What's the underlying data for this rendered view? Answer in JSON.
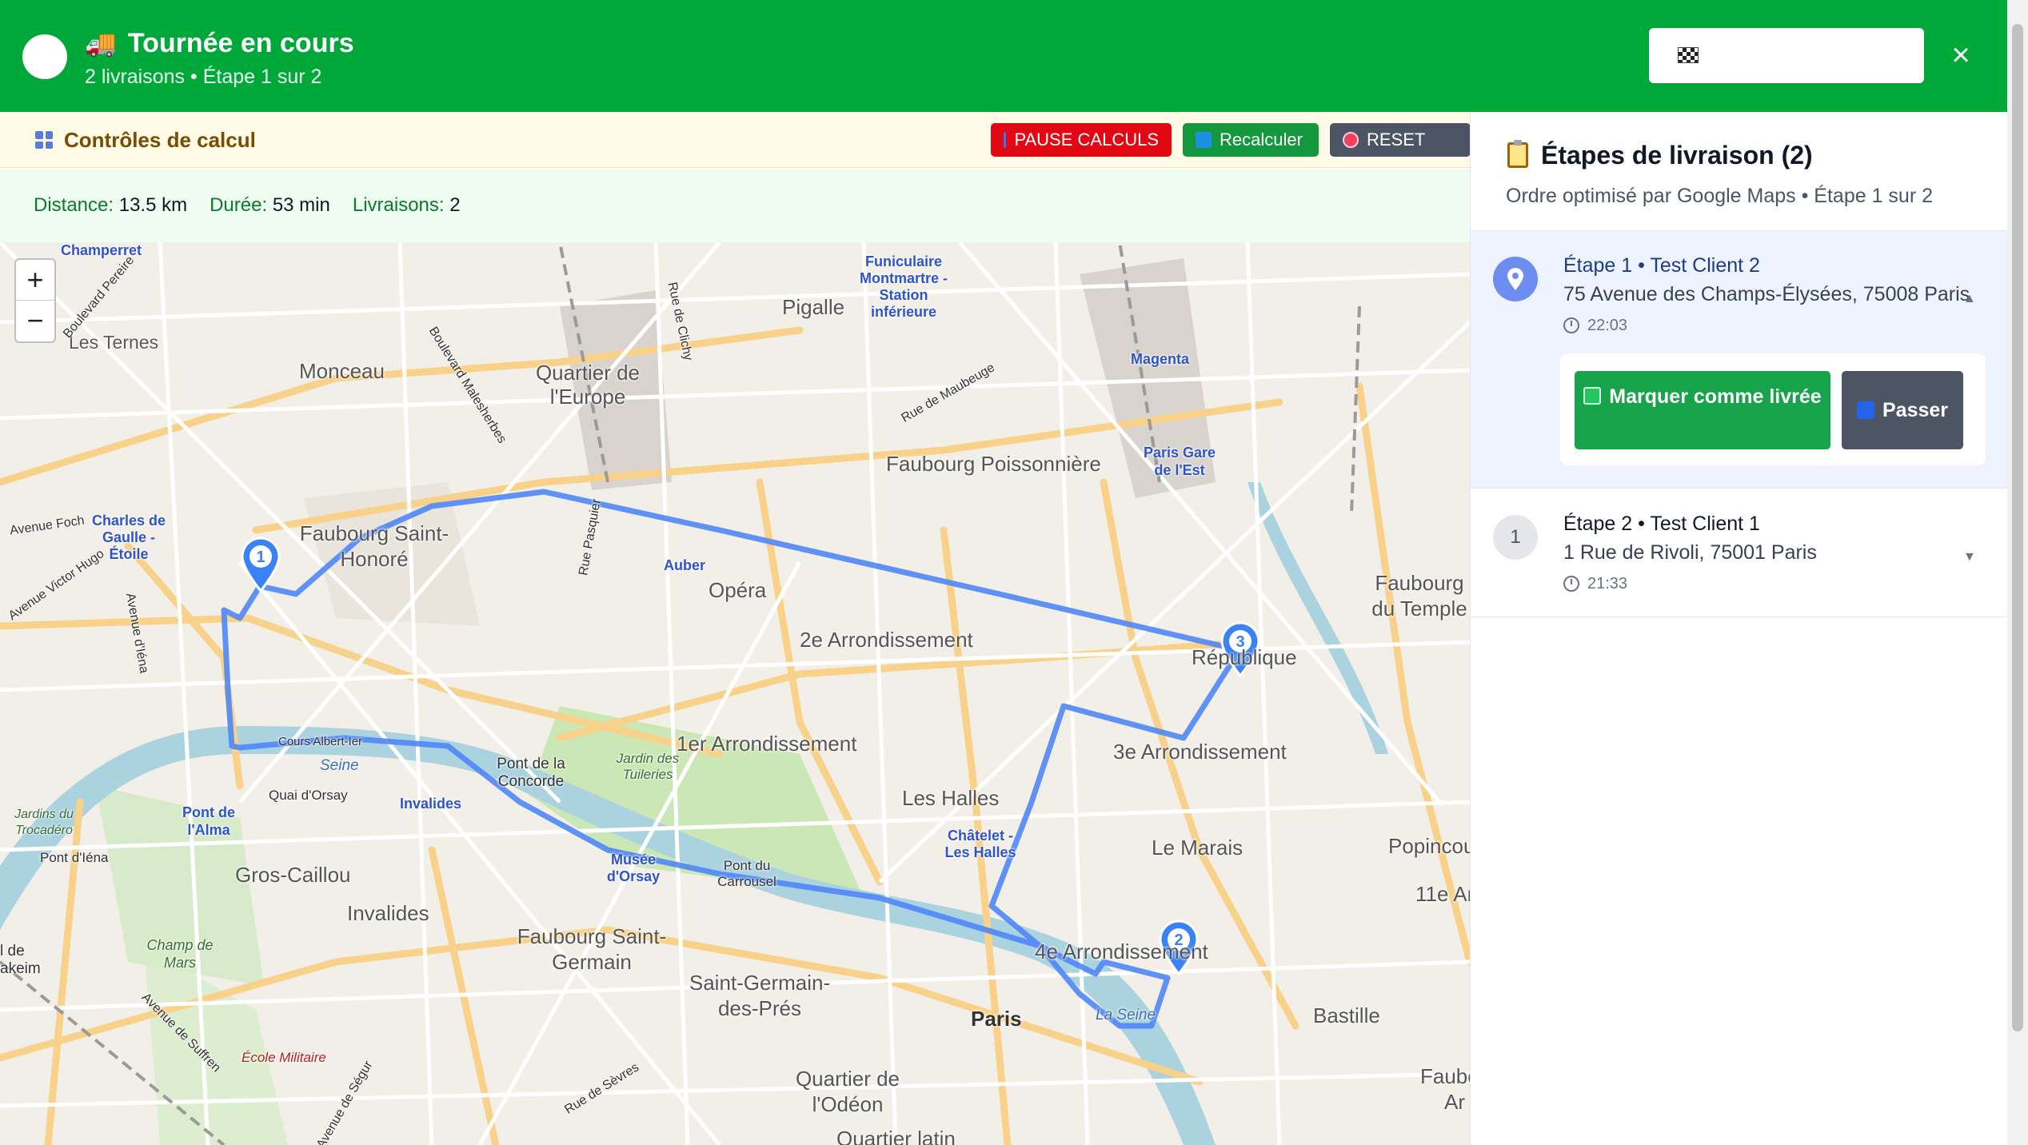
{
  "header": {
    "title": "Tournée en cours",
    "subtitle": "2 livraisons • Étape 1 sur 2",
    "close_label": "×",
    "truck": "🚚"
  },
  "controls": {
    "title": "Contrôles de calcul",
    "pause_label": "PAUSE CALCULS",
    "recalc_label": "Recalculer",
    "reset_label": "RESET"
  },
  "stats": {
    "distance_label": "Distance:",
    "distance_value": "13.5 km",
    "duration_label": "Durée:",
    "duration_value": "53 min",
    "deliveries_label": "Livraisons:",
    "deliveries_value": "2"
  },
  "map": {
    "zoom_in": "+",
    "zoom_out": "−",
    "labels": {
      "champerret": "Champerret",
      "ternes": "Les Ternes",
      "monceau": "Monceau",
      "quartier_europe": "Quartier de l'Europe",
      "pigalle": "Pigalle",
      "funiculaire": "Funiculaire Montmartre - Station inférieure",
      "magenta": "Magenta",
      "faubourg_poissonniere": "Faubourg Poissonnière",
      "gare_est": "Paris Gare de l'Est",
      "charles_de_gaulle": "Charles de Gaulle - Étoile",
      "faubourg_st_honore": "Faubourg Saint-Honoré",
      "auber": "Auber",
      "opera": "Opéra",
      "faubourg_temple": "Faubourg du Temple",
      "deuxieme": "2e Arrondissement",
      "republique": "République",
      "premier": "1er Arrondissement",
      "troisieme": "3e Arrondissement",
      "pont_concorde": "Pont de la Concorde",
      "jardin_tuileries": "Jardin des Tuileries",
      "invalides_stop": "Invalides",
      "pont_alma": "Pont de l'Alma",
      "quai_orsay": "Quai d'Orsay",
      "les_halles": "Les Halles",
      "chatelet": "Châtelet - Les Halles",
      "le_marais": "Le Marais",
      "popincourt": "Popincourt",
      "gros_caillou": "Gros-Caillou",
      "musee_orsay": "Musée d'Orsay",
      "pont_carrousel": "Pont du Carrousel",
      "invalides": "Invalides",
      "faubourg_st_germain": "Faubourg Saint-Germain",
      "quatrieme": "4e Arrondissement",
      "onzieme": "11e Ar",
      "st_germain_pres": "Saint-Germain-des-Prés",
      "paris": "Paris",
      "bastille": "Bastille",
      "champ_mars": "Champ de Mars",
      "ecole_militaire": "École Militaire",
      "quartier_odeon": "Quartier de l'Odéon",
      "quartier_latin": "Quartier latin",
      "pont_iena": "Pont d'Iéna",
      "jardins_trocadero": "Jardins du Trocadéro",
      "seine": "Seine",
      "la_seine": "La Seine",
      "avenue_foch": "Avenue Foch",
      "victor_hugo": "Avenue Victor Hugo",
      "malesherbes": "Boulevard Malesherbes",
      "maubeuge": "Rue de Maubeuge",
      "clichy": "Rue de Clichy",
      "pasquier": "Rue Pasquier",
      "cours_albert": "Cours Albert-Ier",
      "suffren": "Avenue de Suffren",
      "segur": "Avenue de Ségur",
      "sevres": "Rue de Sèvres",
      "pereire": "Boulevard Pereire",
      "iena": "Avenue d'Iéna",
      "faubourg": "Faubo",
      "arr": "Ar",
      "kleim": "akeim",
      "lde": "l de"
    },
    "markers": [
      {
        "label": "1",
        "x_frac": 0
      },
      {
        "label": "2"
      },
      {
        "label": "3"
      }
    ]
  },
  "panel": {
    "title": "Étapes de livraison (2)",
    "subtitle": "Ordre optimisé par Google Maps • Étape 1 sur 2",
    "stops": [
      {
        "title": "Étape 1 • Test Client 2",
        "address": "75 Avenue des Champs-Élysées, 75008 Paris",
        "time": "22:03",
        "deliver_label": "Marquer comme livrée",
        "skip_label": "Passer"
      },
      {
        "number": "1",
        "title": "Étape 2 • Test Client 1",
        "address": "1 Rue de Rivoli, 75001 Paris",
        "time": "21:33"
      }
    ]
  },
  "colors": {
    "header_green": "#00a83a",
    "route_blue": "#4f86f7",
    "pause_red": "#e30613",
    "recalc_green": "#14983e",
    "reset_gray": "#4b5563"
  }
}
